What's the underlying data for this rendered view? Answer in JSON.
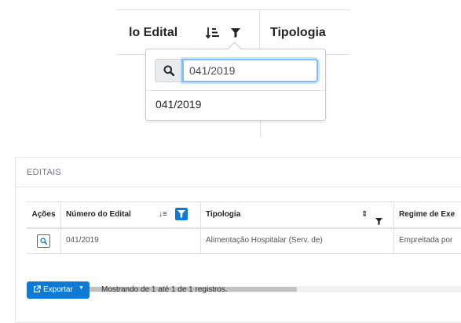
{
  "zoom": {
    "header_edital": "lo Edital",
    "header_tipologia": "Tipologia",
    "sort_icon": "sort-amount-down-icon",
    "filter_icon": "filter-icon",
    "search_value": "041/2019",
    "option": "041/2019"
  },
  "card": {
    "title": "EDITAIS",
    "columns": [
      "Ações",
      "Número do Edital",
      "Tipologia",
      "Regime de Exe"
    ],
    "row": {
      "numero": "041/2019",
      "tipologia": "Alimentação Hospitalar (Serv. de)",
      "regime": "Empreitada por"
    },
    "sort_glyph_numero": "↓≡",
    "sort_glyph_tipologia": "⇕",
    "export_label": "Exportar",
    "records_text": "Mostrando de 1 até 1 de 1 registros."
  },
  "colors": {
    "primary": "#0d7bd6",
    "focus_border": "#80bdff"
  }
}
